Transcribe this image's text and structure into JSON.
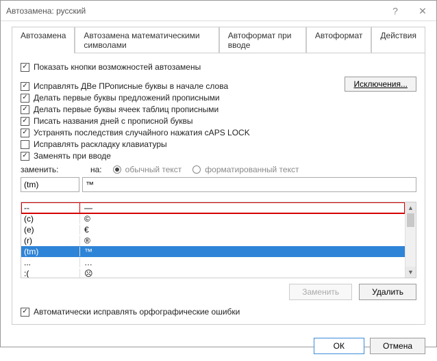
{
  "window": {
    "title": "Автозамена: русский"
  },
  "tabs": [
    {
      "label": "Автозамена",
      "active": true
    },
    {
      "label": "Автозамена математическими символами",
      "active": false
    },
    {
      "label": "Автоформат при вводе",
      "active": false
    },
    {
      "label": "Автоформат",
      "active": false
    },
    {
      "label": "Действия",
      "active": false
    }
  ],
  "checkboxes": {
    "show_buttons": {
      "label": "Показать кнопки возможностей автозамены",
      "checked": true
    },
    "two_caps": {
      "label": "Исправлять ДВе ПРописные буквы в начале слова",
      "checked": true
    },
    "sent_cap": {
      "label": "Делать первые буквы предложений прописными",
      "checked": true
    },
    "table_cap": {
      "label": "Делать первые буквы ячеек таблиц прописными",
      "checked": true
    },
    "day_cap": {
      "label": "Писать названия дней с прописной буквы",
      "checked": true
    },
    "caps_lock": {
      "label": "Устранять последствия случайного нажатия cAPS LOCK",
      "checked": true
    },
    "keyboard": {
      "label": "Исправлять раскладку клавиатуры",
      "checked": false
    },
    "replace_typing": {
      "label": "Заменять при вводе",
      "checked": true
    },
    "auto_fix": {
      "label": "Автоматически исправлять орфографические ошибки",
      "checked": true
    }
  },
  "exceptions_btn": "Исключения...",
  "columns": {
    "replace": "заменить:",
    "with": "на:"
  },
  "radios": {
    "plain": {
      "label": "обычный текст",
      "checked": true
    },
    "formatted": {
      "label": "форматированный текст",
      "checked": false
    }
  },
  "inputs": {
    "replace_value": "(tm)",
    "with_value": "™"
  },
  "list": [
    {
      "replace": "--",
      "with": "—",
      "highlighted": true
    },
    {
      "replace": "(c)",
      "with": "©"
    },
    {
      "replace": "(e)",
      "with": "€"
    },
    {
      "replace": "(r)",
      "with": "®"
    },
    {
      "replace": "(tm)",
      "with": "™",
      "selected": true
    },
    {
      "replace": "...",
      "with": "…"
    },
    {
      "replace": ":(",
      "with": "☹"
    }
  ],
  "buttons": {
    "replace": "Заменить",
    "delete": "Удалить",
    "ok": "ОК",
    "cancel": "Отмена"
  }
}
